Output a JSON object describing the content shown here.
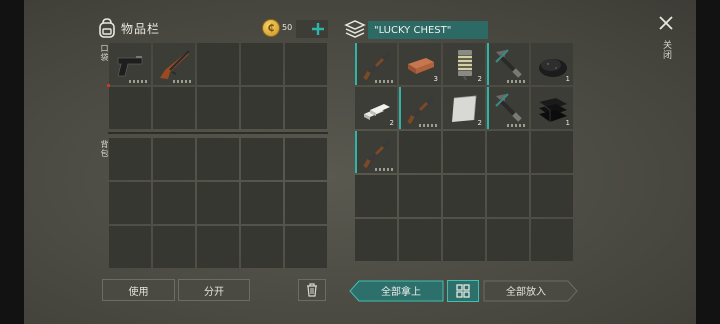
{
  "inventory": {
    "title": "物品栏",
    "coin_count": "50",
    "pocket_label": "口袋",
    "backpack_label": "背包"
  },
  "chest": {
    "title": "\"LUCKY CHEST\"",
    "close_label": "关闭"
  },
  "buttons": {
    "use": "使用",
    "split": "分开",
    "take_all": "全部拿上",
    "put_all": "全部放入"
  },
  "pocket_items": [
    {
      "slot": 1,
      "item": "pistol-icon"
    },
    {
      "slot": 2,
      "item": "hunting-rifle-icon"
    }
  ],
  "chest_items": [
    {
      "slot": 1,
      "item": "pump-shotgun-icon"
    },
    {
      "slot": 2,
      "item": "copper-ingot-icon",
      "count": "3"
    },
    {
      "slot": 3,
      "item": "spring-icon",
      "count": "2"
    },
    {
      "slot": 4,
      "item": "crossbow-icon"
    },
    {
      "slot": 5,
      "item": "coal-icon",
      "count": "1"
    },
    {
      "slot": 6,
      "item": "aluminum-bars-icon",
      "count": "2"
    },
    {
      "slot": 7,
      "item": "pump-shotgun-icon"
    },
    {
      "slot": 8,
      "item": "metal-plate-icon",
      "count": "2"
    },
    {
      "slot": 9,
      "item": "crossbow-icon"
    },
    {
      "slot": 10,
      "item": "leather-icon",
      "count": "1"
    },
    {
      "slot": 11,
      "item": "pump-shotgun-icon"
    }
  ],
  "colors": {
    "accent_teal": "#2fb4a8",
    "button_teal": "#2c6f6b",
    "coin_gold": "#e3b23c"
  }
}
